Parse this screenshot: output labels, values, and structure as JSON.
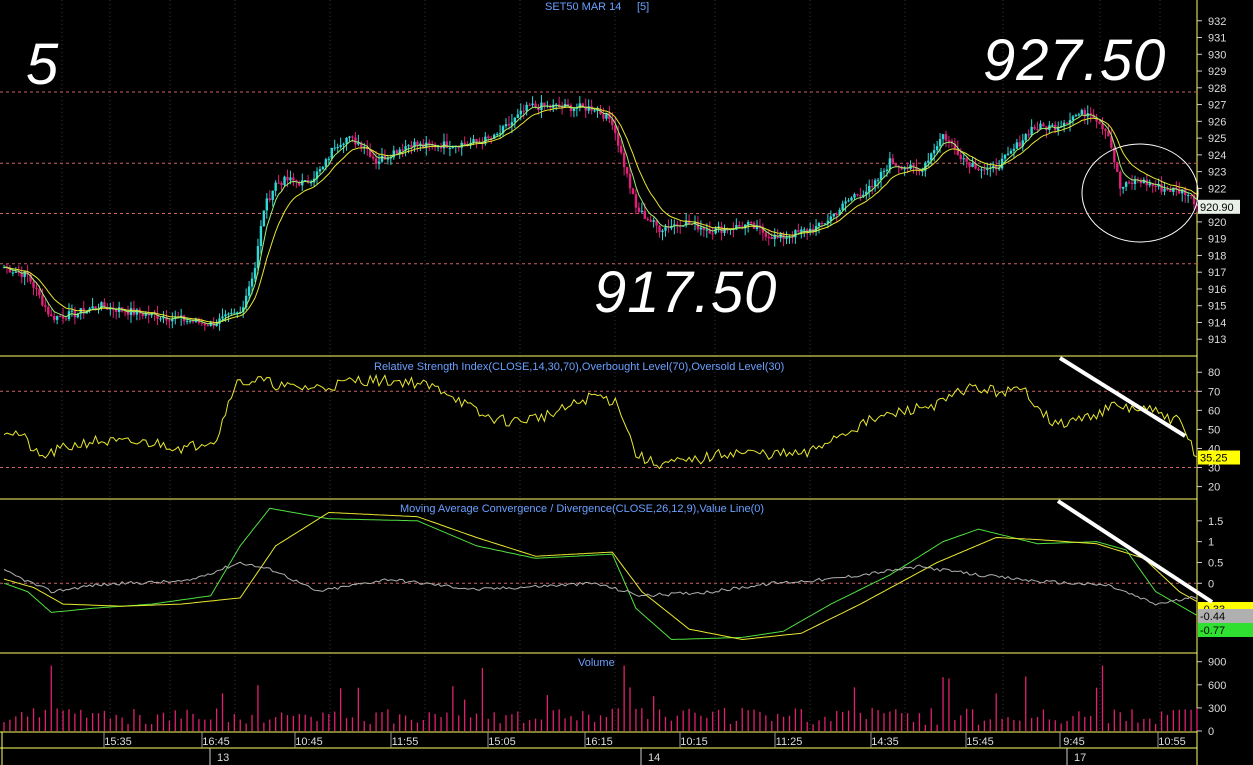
{
  "chart_data": [
    {
      "type": "candlestick",
      "title": "SET50 MAR 14",
      "subtitle": "[5]",
      "ylim": [
        912,
        933
      ],
      "yticks": [
        913,
        914,
        915,
        916,
        917,
        918,
        919,
        920,
        921,
        922,
        923,
        924,
        925,
        926,
        927,
        928,
        929,
        930,
        931,
        932
      ],
      "hlines": [
        927.75,
        923.5,
        920.5,
        917.5
      ],
      "last_value": "920.90",
      "annotations": {
        "interval": "5",
        "high": "927.50",
        "low": "917.50"
      },
      "close_path": [
        [
          0,
          917.3
        ],
        [
          8,
          916.8
        ],
        [
          16,
          914.3
        ],
        [
          24,
          914.5
        ],
        [
          32,
          915.0
        ],
        [
          44,
          914.6
        ],
        [
          56,
          914.3
        ],
        [
          70,
          913.9
        ],
        [
          80,
          914.6
        ],
        [
          85,
          917.3
        ],
        [
          88,
          920.8
        ],
        [
          92,
          922.3
        ],
        [
          96,
          922.5
        ],
        [
          102,
          922.3
        ],
        [
          108,
          923.2
        ],
        [
          112,
          924.6
        ],
        [
          116,
          925.0
        ],
        [
          122,
          924.6
        ],
        [
          126,
          923.6
        ],
        [
          132,
          924.2
        ],
        [
          138,
          924.7
        ],
        [
          142,
          924.5
        ],
        [
          148,
          924.6
        ],
        [
          158,
          924.7
        ],
        [
          166,
          925.0
        ],
        [
          178,
          926.9
        ],
        [
          200,
          926.8
        ],
        [
          206,
          926.0
        ],
        [
          214,
          920.8
        ],
        [
          222,
          919.6
        ],
        [
          230,
          920.0
        ],
        [
          240,
          919.5
        ],
        [
          252,
          919.8
        ],
        [
          262,
          919.0
        ],
        [
          270,
          919.4
        ],
        [
          276,
          919.7
        ],
        [
          282,
          920.6
        ],
        [
          288,
          921.6
        ],
        [
          294,
          922.0
        ],
        [
          300,
          923.6
        ],
        [
          310,
          923.0
        ],
        [
          318,
          925.2
        ],
        [
          326,
          923.6
        ],
        [
          334,
          923.0
        ],
        [
          340,
          923.9
        ],
        [
          348,
          925.6
        ],
        [
          356,
          925.7
        ],
        [
          362,
          926.3
        ],
        [
          368,
          926.6
        ],
        [
          374,
          925.3
        ],
        [
          378,
          922.0
        ],
        [
          384,
          922.5
        ],
        [
          392,
          922.0
        ],
        [
          400,
          921.8
        ],
        [
          404,
          921.1
        ]
      ],
      "volume_label": "Volume",
      "volume_ylim": [
        0,
        1000
      ],
      "volume_ticks": [
        0,
        300,
        600,
        900
      ]
    },
    {
      "type": "line",
      "title": "Relative Strength Index(CLOSE,14,30,70),Overbought Level(70),Oversold Level(30)",
      "ylim": [
        14,
        88
      ],
      "yticks": [
        20,
        30,
        40,
        50,
        60,
        70,
        80
      ],
      "levels": [
        70,
        30
      ],
      "last_value": "35.25",
      "series": [
        {
          "name": "",
          "values": [
            [
              0,
              50
            ],
            [
              6,
              47
            ],
            [
              12,
              35
            ],
            [
              20,
              40
            ],
            [
              30,
              44
            ],
            [
              40,
              43
            ],
            [
              50,
              43
            ],
            [
              55,
              42
            ],
            [
              62,
              40
            ],
            [
              68,
              44
            ],
            [
              72,
              45
            ],
            [
              78,
              74
            ],
            [
              86,
              76
            ],
            [
              96,
              72
            ],
            [
              108,
              72
            ],
            [
              120,
              76
            ],
            [
              138,
              75
            ],
            [
              150,
              70
            ],
            [
              162,
              57
            ],
            [
              172,
              54
            ],
            [
              186,
              58
            ],
            [
              200,
              68
            ],
            [
              208,
              64
            ],
            [
              214,
              37
            ],
            [
              220,
              32
            ],
            [
              232,
              33
            ],
            [
              246,
              38
            ],
            [
              260,
              37
            ],
            [
              272,
              37
            ],
            [
              280,
              45
            ],
            [
              294,
              55
            ],
            [
              306,
              60
            ],
            [
              318,
              64
            ],
            [
              326,
              72
            ],
            [
              336,
              70
            ],
            [
              346,
              70
            ],
            [
              356,
              52
            ],
            [
              366,
              56
            ],
            [
              376,
              62
            ],
            [
              388,
              60
            ],
            [
              398,
              54
            ],
            [
              404,
              36
            ]
          ]
        }
      ]
    },
    {
      "type": "line",
      "title": "Moving Average Convergence / Divergence(CLOSE,26,12,9),Value Line(0)",
      "ylim": [
        -1.65,
        2.0
      ],
      "yticks": [
        0,
        0.5,
        1,
        1.5
      ],
      "levels": [
        0
      ],
      "last_values": [
        "-0.33",
        "-0.44",
        "-0.77"
      ],
      "series": [
        {
          "name": "",
          "color": "#50e040",
          "values": [
            [
              0,
              0.0
            ],
            [
              8,
              -0.2
            ],
            [
              16,
              -0.7
            ],
            [
              30,
              -0.6
            ],
            [
              50,
              -0.5
            ],
            [
              70,
              -0.3
            ],
            [
              80,
              0.9
            ],
            [
              90,
              1.8
            ],
            [
              110,
              1.55
            ],
            [
              140,
              1.5
            ],
            [
              160,
              0.9
            ],
            [
              180,
              0.6
            ],
            [
              206,
              0.7
            ],
            [
              214,
              -0.6
            ],
            [
              226,
              -1.35
            ],
            [
              250,
              -1.3
            ],
            [
              264,
              -1.15
            ],
            [
              280,
              -0.5
            ],
            [
              300,
              0.2
            ],
            [
              318,
              1.0
            ],
            [
              330,
              1.3
            ],
            [
              350,
              0.95
            ],
            [
              370,
              1.0
            ],
            [
              380,
              0.8
            ],
            [
              390,
              -0.2
            ],
            [
              404,
              -0.77
            ]
          ]
        },
        {
          "name": "",
          "color": "#e8e830",
          "values": [
            [
              0,
              0.1
            ],
            [
              10,
              -0.1
            ],
            [
              20,
              -0.5
            ],
            [
              40,
              -0.55
            ],
            [
              60,
              -0.5
            ],
            [
              80,
              -0.35
            ],
            [
              92,
              0.9
            ],
            [
              110,
              1.7
            ],
            [
              140,
              1.6
            ],
            [
              160,
              1.1
            ],
            [
              180,
              0.65
            ],
            [
              206,
              0.75
            ],
            [
              216,
              -0.2
            ],
            [
              232,
              -1.1
            ],
            [
              250,
              -1.35
            ],
            [
              270,
              -1.2
            ],
            [
              290,
              -0.5
            ],
            [
              316,
              0.5
            ],
            [
              336,
              1.1
            ],
            [
              350,
              1.05
            ],
            [
              370,
              0.95
            ],
            [
              386,
              0.6
            ],
            [
              398,
              -0.2
            ],
            [
              404,
              -0.44
            ]
          ]
        },
        {
          "name": "",
          "color": "#b0b0b0",
          "values": [
            [
              0,
              0.3
            ],
            [
              16,
              -0.2
            ],
            [
              30,
              -0.05
            ],
            [
              40,
              0.0
            ],
            [
              62,
              0.05
            ],
            [
              80,
              0.5
            ],
            [
              92,
              0.3
            ],
            [
              106,
              -0.2
            ],
            [
              130,
              0.1
            ],
            [
              160,
              -0.15
            ],
            [
              200,
              0.0
            ],
            [
              216,
              -0.3
            ],
            [
              240,
              -0.2
            ],
            [
              260,
              0.0
            ],
            [
              280,
              0.1
            ],
            [
              310,
              0.4
            ],
            [
              330,
              0.2
            ],
            [
              350,
              0.05
            ],
            [
              374,
              -0.05
            ],
            [
              390,
              -0.5
            ],
            [
              404,
              -0.33
            ]
          ]
        }
      ]
    }
  ],
  "x_axis": {
    "time_labels": [
      "15:35",
      "16:45",
      "10:45",
      "11:55",
      "15:05",
      "16:15",
      "10:15",
      "11:25",
      "14:35",
      "15:45",
      "9:45",
      "10:55"
    ],
    "day_labels": [
      "13",
      "14",
      "17"
    ]
  }
}
